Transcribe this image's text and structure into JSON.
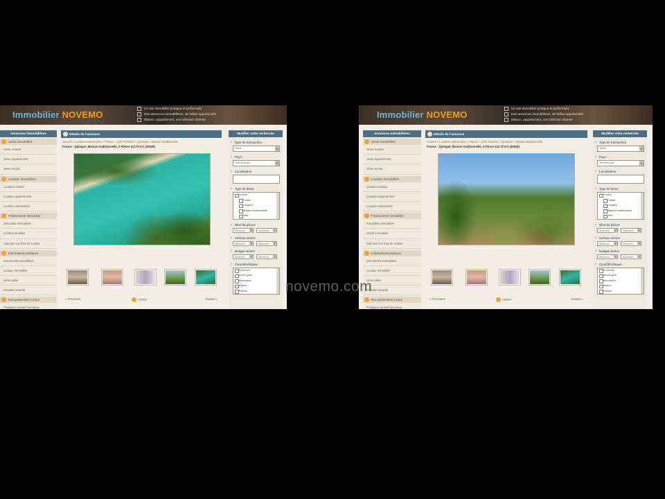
{
  "brand": {
    "word1": "Immobilier",
    "word2": "NOVEMO"
  },
  "taglines": [
    "Un site immobilier pratique et performant",
    "Des annonces immobilières, de belles opportunités",
    "Maison, appartement, une sélection diverse"
  ],
  "left_nav": {
    "title": "Annonces immobilières",
    "sections": [
      {
        "label": "Vente immobilière",
        "items": [
          "Vente maison",
          "Vente appartement",
          "Vente terrain"
        ]
      },
      {
        "label": "Location immobilière",
        "items": [
          "Location maison",
          "Location appartement",
          "Location saisonnière"
        ]
      },
      {
        "label": "Financement immobilier",
        "items": [
          "Simulation immobilier",
          "Crédit immobilier",
          "Calculez vos frais de notaire"
        ]
      },
      {
        "label": "Informations pratiques",
        "items": [
          "Documents immobiliers",
          "Lexique immobilier",
          "Liens utiles",
          "Fiscalité sécurité"
        ]
      },
      {
        "label": "Nos partenaires locaux",
        "items": [
          "Pratiques conseil Nouveaux"
        ]
      }
    ]
  },
  "main": {
    "title": "Détails de l'annonce",
    "breadcrumb": "Accueil » Location saisonnière » France » (29) Finistère » Quimper » Maison traditionnelle",
    "property_title": "France - Quimper, Maison traditionnelle, 3 Pièces (±2.70 m²) (20626)",
    "pager": {
      "prev": "« Précédent",
      "back": "Ajouter",
      "next": "Suivant »"
    }
  },
  "search": {
    "title": "Modifier votre recherche",
    "transaction": {
      "label": "Type de transaction",
      "value": "Vente"
    },
    "country": {
      "label": "Pays :",
      "value": "Sélectionnez"
    },
    "location": {
      "label": "Localisation"
    },
    "property_type": {
      "label": "Type de biens",
      "items": [
        "France",
        "Chalet",
        "Longère",
        "Maison traditionnelle",
        "Villa"
      ]
    },
    "rooms": {
      "label": "Nbre de pièces",
      "min": "Minimum",
      "max": "Maximum"
    },
    "surface": {
      "label": "Surface min/m²",
      "min": "Minimum",
      "max": "Maximum"
    },
    "budget": {
      "label": "Budget min/m²",
      "min": "Minimum",
      "max": "Maximum"
    },
    "features": {
      "label": "Caractéristiques",
      "items": [
        "A rénover",
        "Accès gare",
        "Ascenseur",
        "Balcon",
        "Piscine"
      ]
    }
  },
  "watermark": "novemo.com",
  "colors": {
    "header_bar": "#4f6e82",
    "accent_orange": "#f29b1e",
    "logo_blue": "#6fb7d8",
    "background": "#000000"
  }
}
